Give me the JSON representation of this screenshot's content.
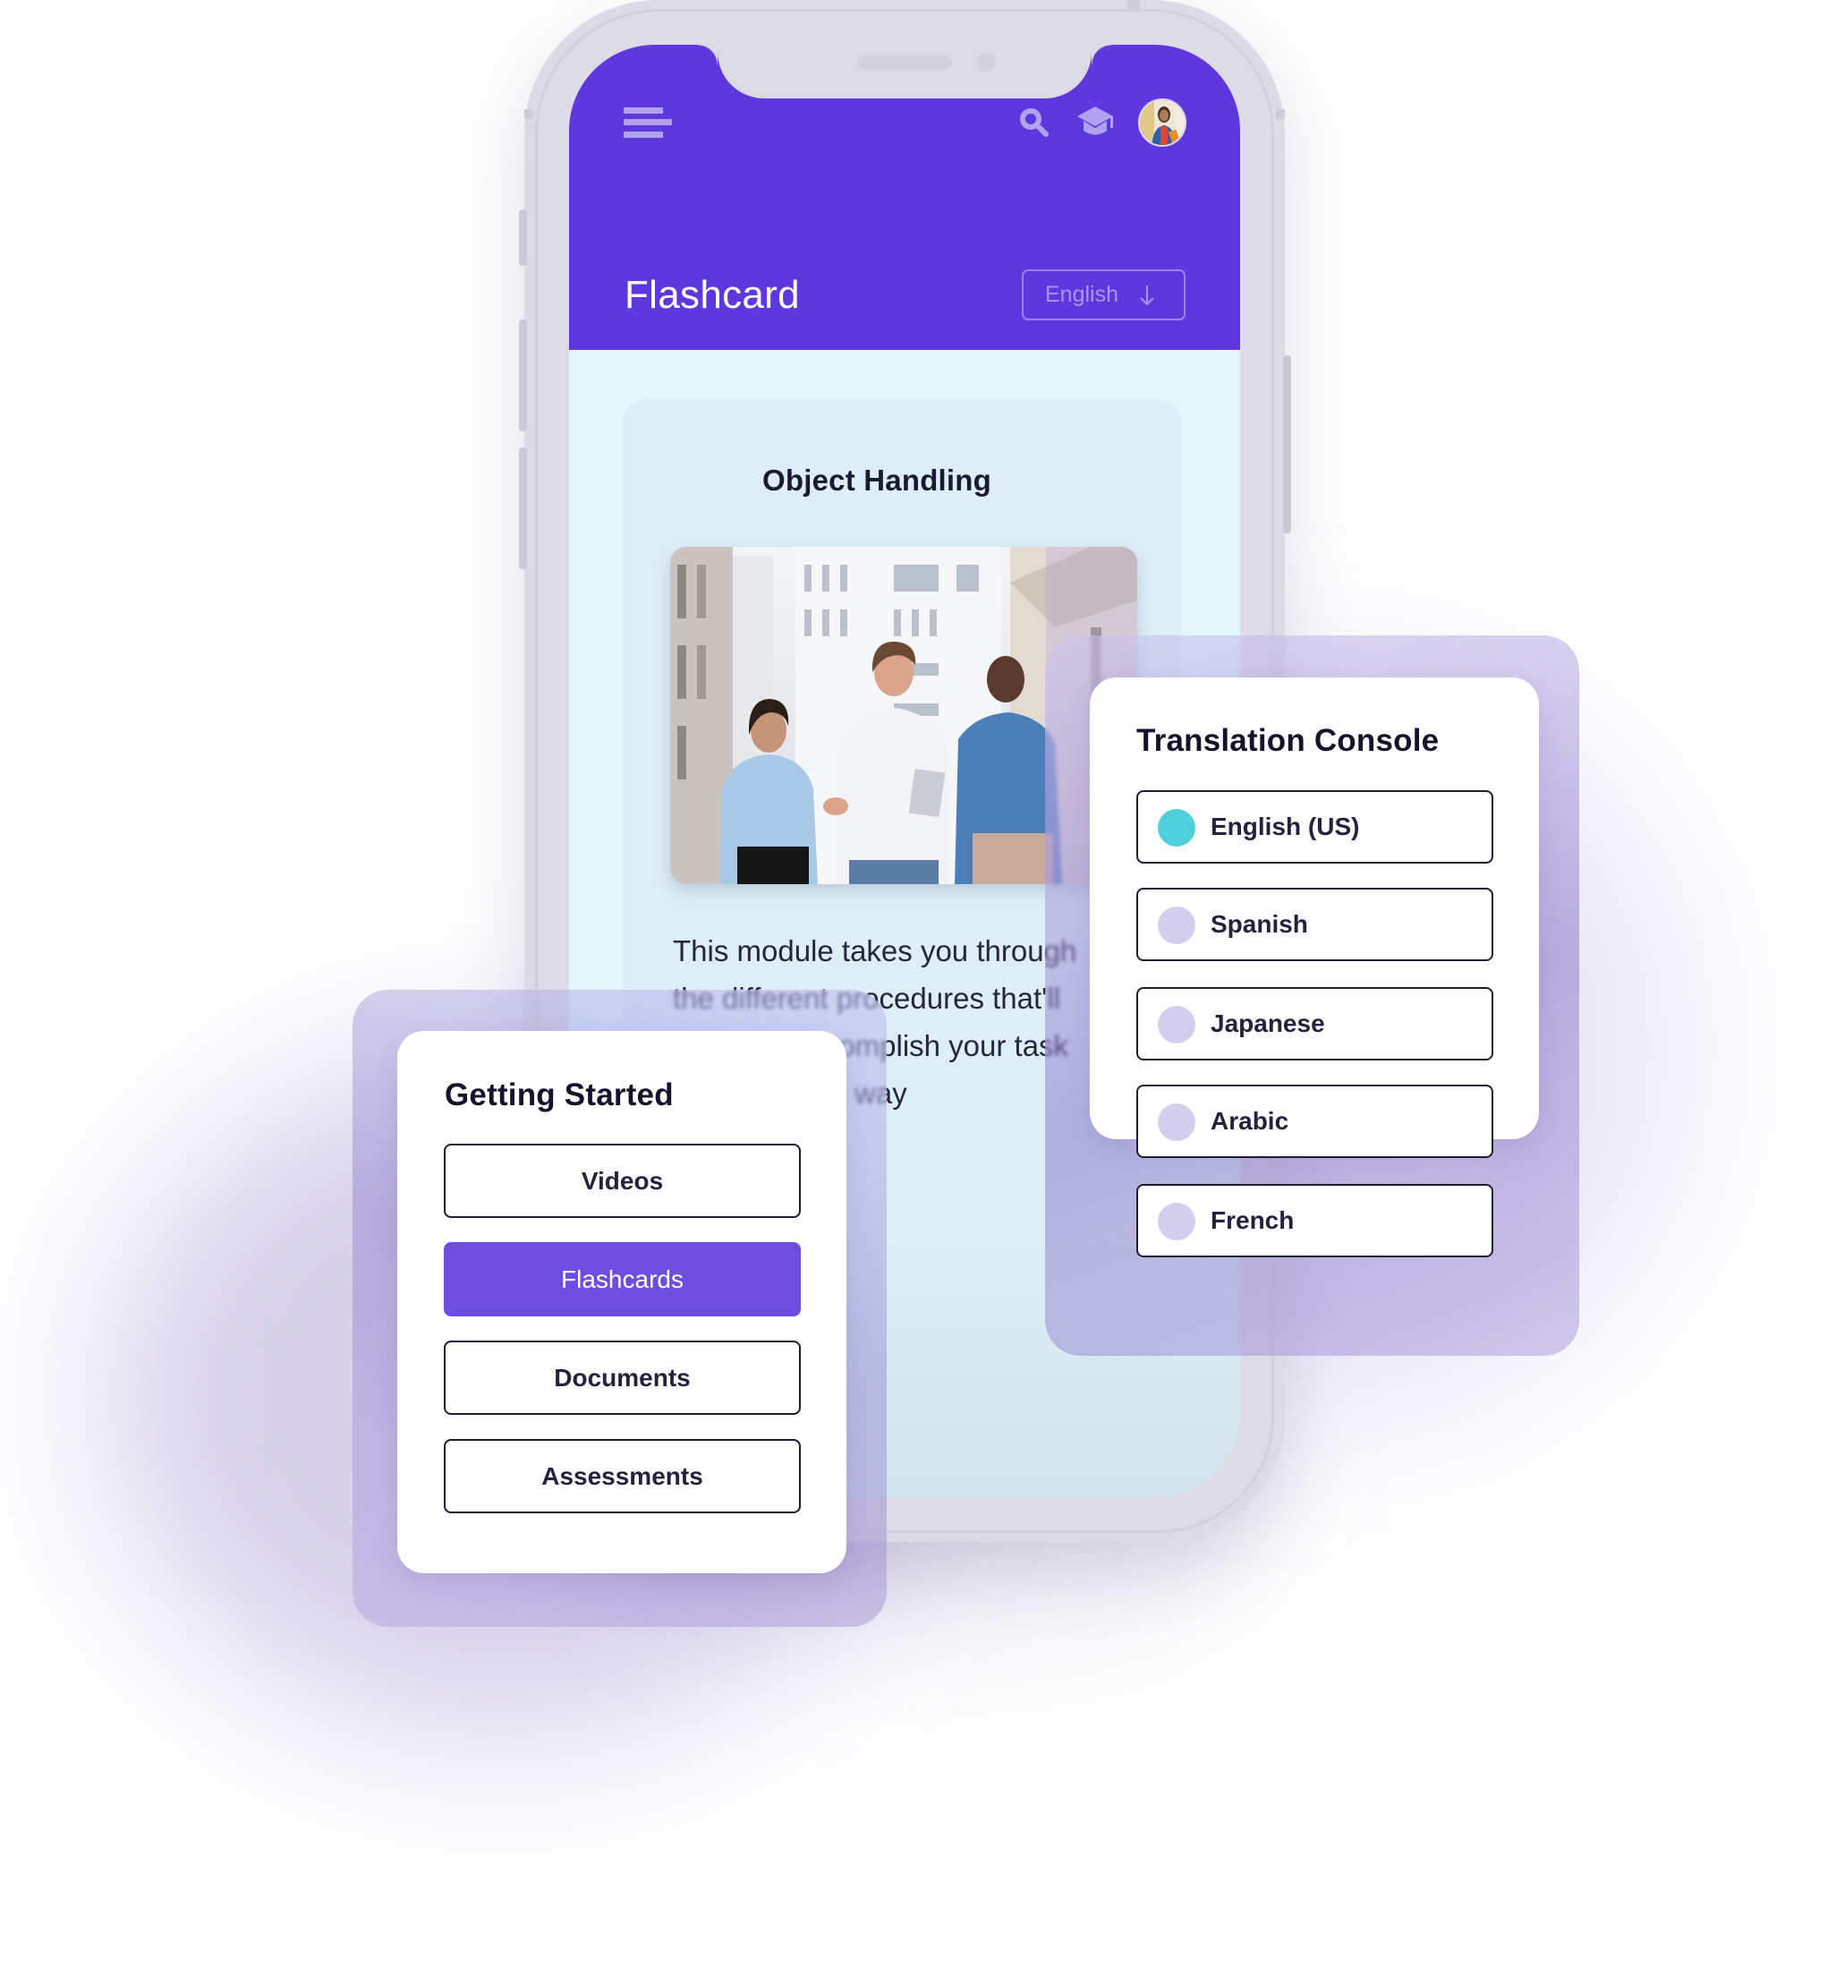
{
  "app": {
    "header": {
      "menu_icon": "hamburger-menu-icon",
      "search_icon": "search-icon",
      "courses_icon": "graduation-cap-icon",
      "avatar": "user-avatar",
      "title": "Flashcard",
      "language_button": {
        "label": "English",
        "icon": "arrow-down-icon"
      }
    },
    "card": {
      "title": "Object Handling",
      "image": "photo of three colleagues walking and talking in a city street",
      "description_lines": [
        "This module takes you through",
        "the different procedures that'll",
        "help you accomplish your task",
        "in an efficient way"
      ]
    }
  },
  "translation_console": {
    "title": "Translation Console",
    "options": [
      {
        "label": "English (US)",
        "selected": true
      },
      {
        "label": "Spanish",
        "selected": false
      },
      {
        "label": "Japanese",
        "selected": false
      },
      {
        "label": "Arabic",
        "selected": false
      },
      {
        "label": "French",
        "selected": false
      }
    ]
  },
  "getting_started": {
    "title": "Getting Started",
    "buttons": [
      {
        "label": "Videos",
        "active": false
      },
      {
        "label": "Flashcards",
        "active": true
      },
      {
        "label": "Documents",
        "active": false
      },
      {
        "label": "Assessments",
        "active": false
      }
    ]
  },
  "colors": {
    "brand_purple": "#5d38de",
    "active_button": "#6d4ee0",
    "selected_radio": "#4fd0dc",
    "unselected_radio": "#d3cdee",
    "screen_background": "#e3f6fb"
  }
}
